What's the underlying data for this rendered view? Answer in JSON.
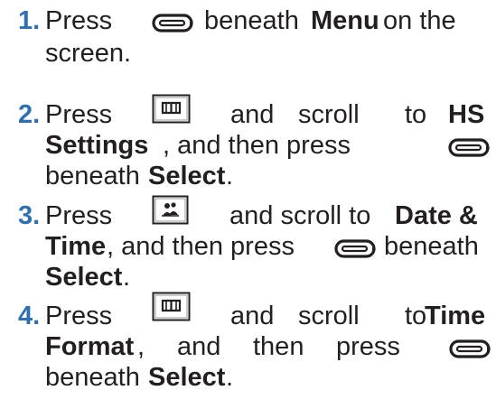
{
  "steps": [
    {
      "number": "1.",
      "lines": [
        [
          "Press",
          "beneath",
          "Menu",
          "on the"
        ],
        [
          "screen."
        ]
      ]
    },
    {
      "number": "2.",
      "lines": [
        [
          "Press",
          "and",
          "scroll",
          "to",
          "HS"
        ],
        [
          "Settings",
          ", and then press"
        ],
        [
          "beneath",
          "Select",
          "."
        ]
      ]
    },
    {
      "number": "3.",
      "lines": [
        [
          "Press",
          "and scroll to",
          "Date &"
        ],
        [
          "Time",
          ", and then press",
          "beneath"
        ],
        [
          "Select",
          "."
        ]
      ]
    },
    {
      "number": "4.",
      "lines": [
        [
          "Press",
          "and",
          "scroll",
          "to",
          "Time"
        ],
        [
          "Format",
          ",",
          "and",
          "then",
          "press"
        ],
        [
          "beneath",
          "Select",
          "."
        ]
      ]
    }
  ],
  "colors": {
    "step_number": "#2e6fb2",
    "text": "#231f20",
    "icon_stroke": "#231f20"
  },
  "icons": {
    "soft_key": "soft-key-icon",
    "phonebook": "phonebook-key-icon",
    "intercom": "intercom-key-icon"
  }
}
